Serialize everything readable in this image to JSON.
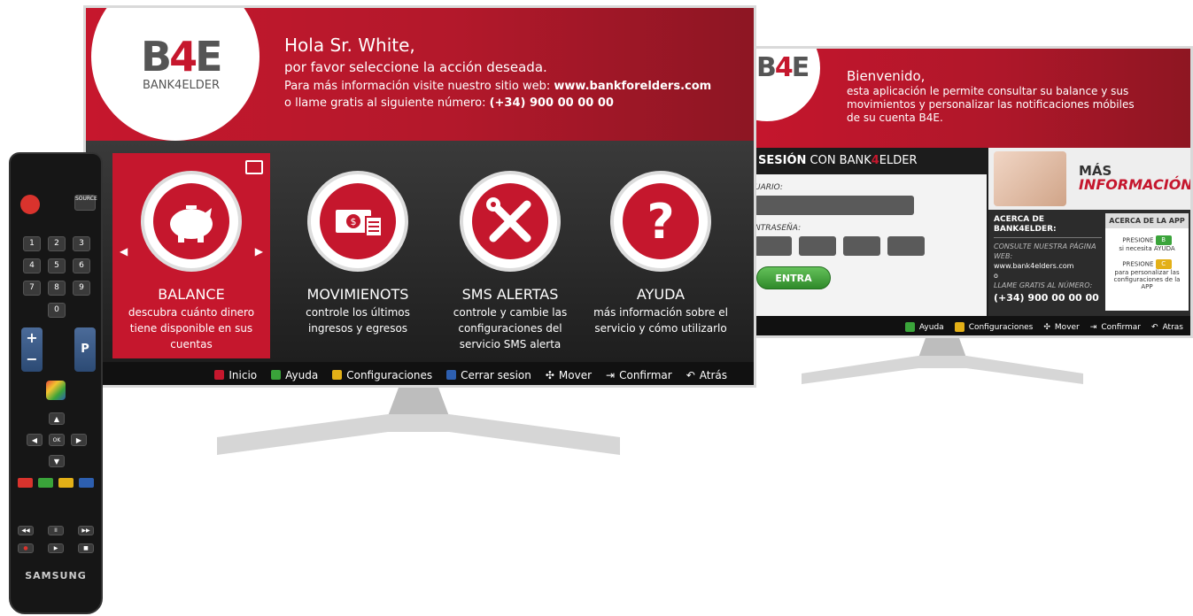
{
  "main_tv": {
    "logo": {
      "b": "B",
      "four": "4",
      "e": "E",
      "subtitle": "BANK4ELDER"
    },
    "header": {
      "greeting": "Hola Sr. White,",
      "prompt": "por favor seleccione la acción deseada.",
      "line3_prefix": "Para más información visite nuestro sitio web: ",
      "website": "www.bankforelders.com",
      "line4_prefix": "o llame gratis al siguiente número: ",
      "phone": "(+34) 900 00 00 00"
    },
    "tiles": [
      {
        "name": "BALANCE",
        "desc": "descubra cuánto dinero tiene disponible en sus cuentas",
        "icon": "piggy-bank-icon",
        "selected": true
      },
      {
        "name": "MOVIMIENOTS",
        "desc": "controle los últimos ingresos y egresos",
        "icon": "money-list-icon",
        "selected": false
      },
      {
        "name": "SMS ALERTAS",
        "desc": "controle y cambie las configuraciones del servicio SMS alerta",
        "icon": "tools-icon",
        "selected": false
      },
      {
        "name": "AYUDA",
        "desc": "más información sobre el servicio y cómo utilizarlo",
        "icon": "question-icon",
        "selected": false
      }
    ],
    "bottom_bar": {
      "inicio": "Inicio",
      "ayuda": "Ayuda",
      "configuraciones": "Configuraciones",
      "cerrar": "Cerrar sesion",
      "mover": "Mover",
      "confirmar": "Confirmar",
      "atras": "Atrás"
    }
  },
  "login_tv": {
    "header": {
      "welcome": "Bienvenido,",
      "line2": "esta aplicación le permite consultar su balance y sus",
      "line3": "movimientos y personalizar las notificaciones móbiles",
      "line4": "de su cuenta B4E."
    },
    "login_title_bold": "SESIÓN",
    "login_title_rest": " CON BANK",
    "login_title_four": "4",
    "login_title_end": "ELDER",
    "user_label": "UARIO:",
    "pass_label": "NTRASEÑA:",
    "enter_button": "ENTRA",
    "info": {
      "mas": "MÁS",
      "informacion": "INFORMACIÓN",
      "about_title": "ACERCA DE BANK4ELDER:",
      "visit": "CONSULTE NUESTRA PÁGINA WEB:",
      "website": "www.bank4elders.com",
      "or": "o",
      "call": "LLAME GRATIS AL NÚMERO:",
      "phone": "(+34) 900 00 00 00",
      "app_title": "ACERCA DE LA APP",
      "press1": "PRESIONE",
      "key1": "B",
      "help_text": "si necesita AYUDA",
      "press2": "PRESIONE",
      "key2": "C",
      "config_text": "para personalizar las configuraciones de la APP"
    },
    "bottom_bar": {
      "ayuda": "Ayuda",
      "configuraciones": "Configuraciones",
      "mover": "Mover",
      "confirmar": "Confirmar",
      "atras": "Atras"
    }
  },
  "remote": {
    "brand": "SAMSUNG",
    "source": "SOURCE",
    "keys": [
      "1",
      "2",
      "3",
      "4",
      "5",
      "6",
      "7",
      "8",
      "9",
      "0"
    ],
    "p": "P"
  },
  "colors": {
    "brand_red": "#c5172d",
    "green": "#3aa43a",
    "yellow": "#e3b017",
    "blue": "#2d5fb0"
  }
}
